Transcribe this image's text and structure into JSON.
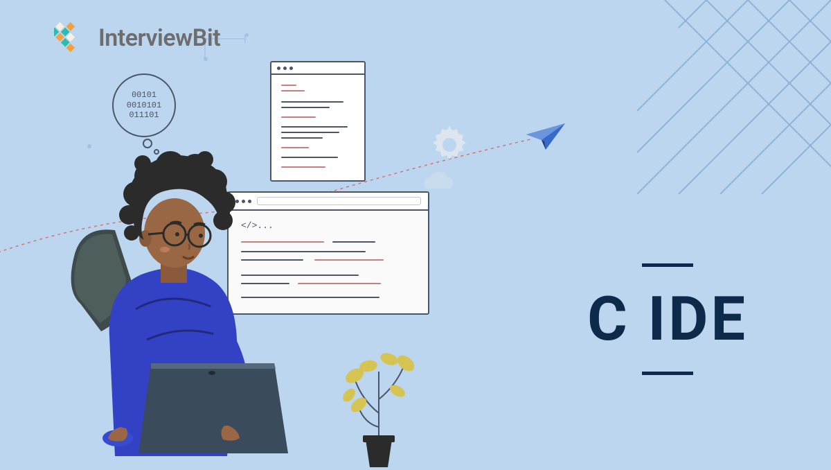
{
  "brand": {
    "name": "InterviewBit"
  },
  "title": {
    "text": "C IDE"
  },
  "binary": {
    "line1": "00101",
    "line2": "0010101",
    "line3": "011101"
  },
  "code_tag": {
    "text": "</>..."
  }
}
